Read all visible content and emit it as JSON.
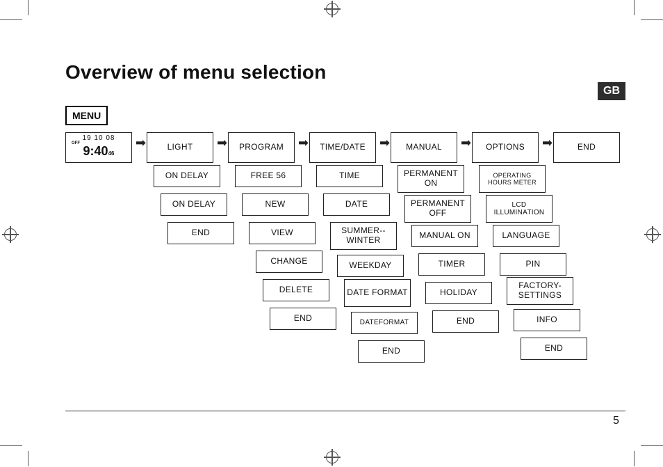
{
  "title": "Overview of menu selection",
  "lang_badge": "GB",
  "page_number": "5",
  "menu_label": "MENU",
  "display": {
    "date": "19   10   08",
    "state": "OFF",
    "time": "9:40",
    "sec": "46"
  },
  "heads": {
    "light": "LIGHT",
    "program": "PROGRAM",
    "timedate": "TIME/DATE",
    "manual": "MANUAL",
    "options": "OPTIONS",
    "end": "END"
  },
  "cols": {
    "light": [
      "ON DELAY",
      "ON DELAY",
      "END"
    ],
    "program": [
      "FREE 56",
      "NEW",
      "VIEW",
      "CHANGE",
      "DELETE",
      "END"
    ],
    "timedate": [
      "TIME",
      "DATE",
      "SUMMER-- WINTER",
      "WEEKDAY",
      "DATE FORMAT",
      "DATEFORMAT",
      "END"
    ],
    "manual": [
      "PERMANENT ON",
      "PERMANENT OFF",
      "MANUAL ON",
      "TIMER",
      "HOLIDAY",
      "END"
    ],
    "options": [
      "OPERATING HOURS METER",
      "LCD ILLUMINATION",
      "LANGUAGE",
      "PIN",
      "FACTORY- SETTINGS",
      "INFO",
      "END"
    ]
  }
}
